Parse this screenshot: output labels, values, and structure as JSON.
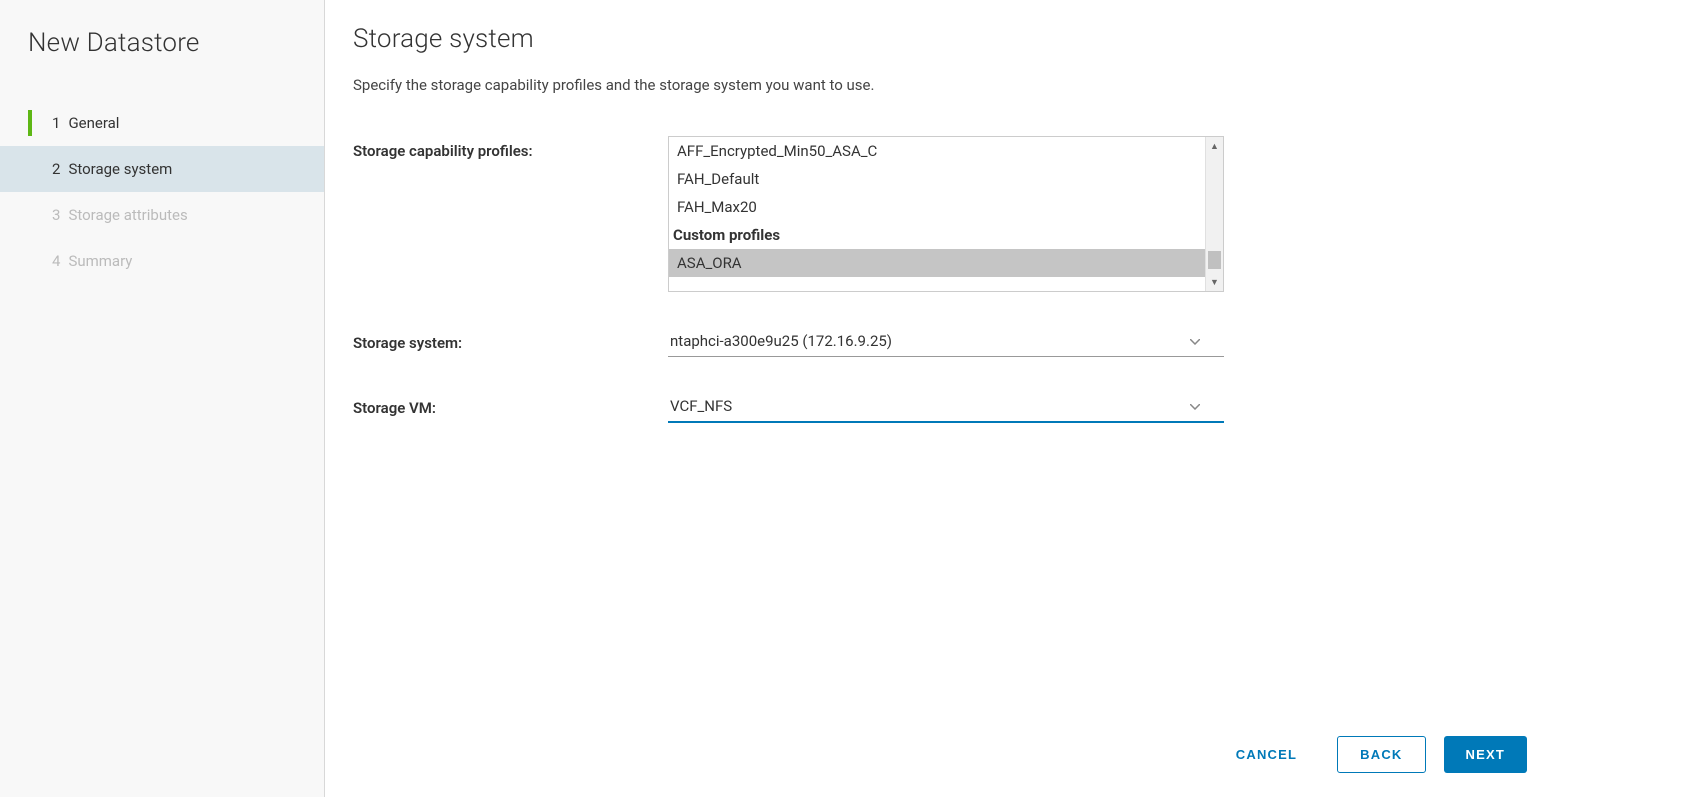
{
  "sidebar": {
    "title": "New Datastore",
    "steps": [
      {
        "num": "1",
        "label": "General",
        "state": "completed"
      },
      {
        "num": "2",
        "label": "Storage system",
        "state": "active"
      },
      {
        "num": "3",
        "label": "Storage attributes",
        "state": "disabled"
      },
      {
        "num": "4",
        "label": "Summary",
        "state": "disabled"
      }
    ]
  },
  "main": {
    "title": "Storage system",
    "desc": "Specify the storage capability profiles and the storage system you want to use.",
    "fields": {
      "profiles_label": "Storage capability profiles:",
      "profiles_options": [
        {
          "label": "AFF_Encrypted_Min50_ASA_C",
          "selected": false
        },
        {
          "label": "FAH_Default",
          "selected": false
        },
        {
          "label": "FAH_Max20",
          "selected": false
        }
      ],
      "profiles_group_header": "Custom profiles",
      "profiles_custom_options": [
        {
          "label": "ASA_ORA",
          "selected": true
        }
      ],
      "system_label": "Storage system:",
      "system_value": "ntaphci-a300e9u25 (172.16.9.25)",
      "vm_label": "Storage VM:",
      "vm_value": "VCF_NFS"
    }
  },
  "footer": {
    "cancel": "CANCEL",
    "back": "BACK",
    "next": "NEXT"
  }
}
